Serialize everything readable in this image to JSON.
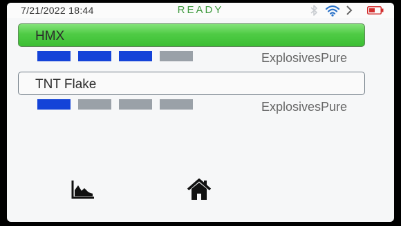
{
  "statusbar": {
    "datetime": "7/21/2022  18:44",
    "status": "READY",
    "icons": [
      "bluetooth-icon",
      "wifi-icon",
      "chevron-right-icon",
      "battery-icon"
    ],
    "battery_color": "#d32f2f",
    "status_color": "#3f9a3f"
  },
  "items": [
    {
      "label": "HMX",
      "category": "ExplosivesPure",
      "selected": true,
      "level": 3,
      "max_level": 4
    },
    {
      "label": "TNT Flake",
      "category": "ExplosivesPure",
      "selected": false,
      "level": 1,
      "max_level": 4
    }
  ],
  "colors": {
    "selected_fill": "#4fcb45",
    "bar_on": "#1443d8",
    "bar_off": "#9aa1a8"
  },
  "toolbar": {
    "icons": [
      "chart-icon",
      "home-icon"
    ]
  }
}
